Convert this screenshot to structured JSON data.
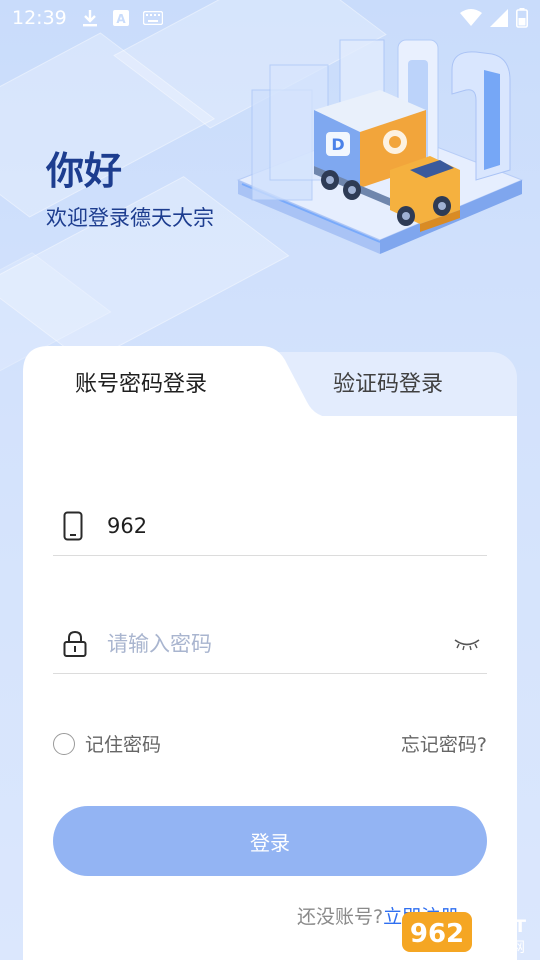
{
  "status_bar": {
    "time": "12:39",
    "icons": [
      "download-icon",
      "a-badge-icon",
      "keyboard-icon",
      "wifi-icon",
      "signal-icon",
      "battery-icon"
    ]
  },
  "hero": {
    "title": "你好",
    "subtitle": "欢迎登录德天大宗",
    "illustration": "delivery-truck-illustration"
  },
  "tabs": [
    {
      "label": "账号密码登录",
      "active": true
    },
    {
      "label": "验证码登录",
      "active": false
    }
  ],
  "phone_field": {
    "value": "962",
    "icon": "phone-icon"
  },
  "password_field": {
    "value": "",
    "placeholder": "请输入密码",
    "icon": "lock-icon",
    "toggle_icon": "eye-closed-icon"
  },
  "remember": {
    "label": "记住密码",
    "checked": false
  },
  "forgot_label": "忘记密码?",
  "login_button_label": "登录",
  "register": {
    "prompt": "还没账号?",
    "link": "立即注册"
  },
  "watermark": {
    "text": "962.NET",
    "subtext": "乐游网"
  },
  "colors": {
    "accent": "#2f6ff0",
    "title": "#1d3d8f",
    "button": "#93b4f3",
    "background": "#c9dcfb"
  }
}
